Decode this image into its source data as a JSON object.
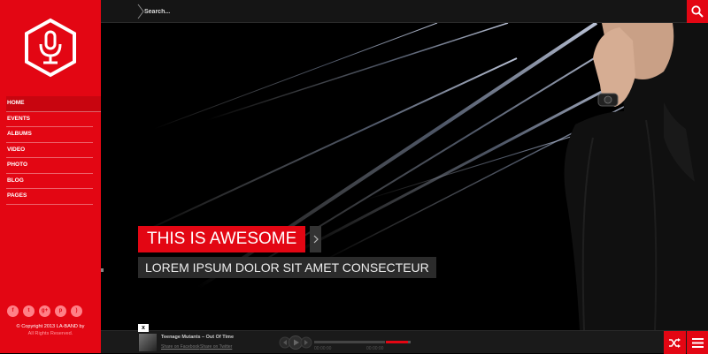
{
  "sidebar": {
    "logo_icon": "microphone-hexagon-icon",
    "nav_items": [
      {
        "label": "HOME"
      },
      {
        "label": "EVENTS"
      },
      {
        "label": "ALBUMS"
      },
      {
        "label": "VIDEO"
      },
      {
        "label": "PHOTO"
      },
      {
        "label": "BLOG"
      },
      {
        "label": "PAGES"
      }
    ],
    "social_icons": [
      "facebook-icon",
      "twitter-icon",
      "google-plus-icon",
      "pinterest-icon",
      "rss-icon"
    ],
    "copyright_line1": "© Copyright 2013 LA-BAND by",
    "copyright_line2": "All Rights Reserved."
  },
  "topbar": {
    "search_placeholder": "Search...",
    "search_icon": "search-icon"
  },
  "hero": {
    "title": "THIS IS AWESOME",
    "subtitle": "LOREM IPSUM DOLOR SIT AMET CONSECTEUR"
  },
  "player": {
    "close_label": "x",
    "track_title": "Teenage Mutants – Out Of Time",
    "share_facebook": "Share on Facebook",
    "share_twitter": "Share on Twitter",
    "time_current": "00:00:00",
    "time_total": "00:00:00"
  },
  "colors": {
    "accent": "#e30613",
    "topbar": "#151515",
    "hero_bg": "#000000",
    "player_bg": "#1a1a1a"
  }
}
